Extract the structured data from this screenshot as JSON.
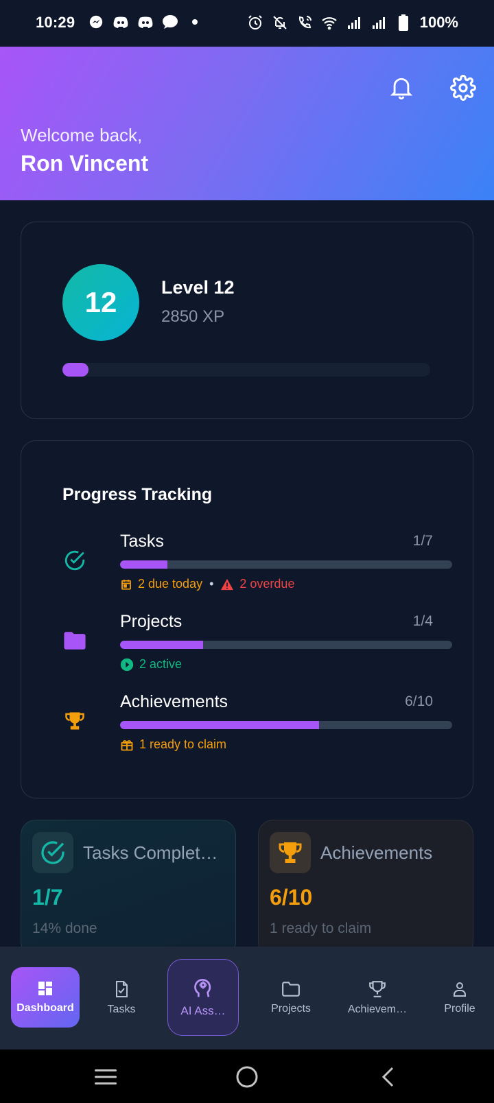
{
  "status_bar": {
    "time": "10:29",
    "battery": "100%",
    "icons_left": [
      "messenger-icon",
      "discord-icon",
      "discord-icon",
      "chat-bubble-icon",
      "dot-icon"
    ],
    "icons_right": [
      "alarm-icon",
      "bell-off-icon",
      "wifi-call-icon",
      "wifi-icon",
      "signal-icon",
      "signal-icon",
      "battery-icon"
    ]
  },
  "header": {
    "welcome": "Welcome back,",
    "username": "Ron Vincent",
    "gradient": [
      "#a855f7",
      "#3b82f6"
    ]
  },
  "level_card": {
    "level_number": "12",
    "level_label": "Level 12",
    "xp": "2850 XP",
    "progress_fraction": 0.07
  },
  "progress_tracking": {
    "title": "Progress Tracking",
    "rows": [
      {
        "label": "Tasks",
        "count": "1/7",
        "fraction": 0.143,
        "icon": "check-circle-icon",
        "sub": [
          {
            "icon": "calendar-icon",
            "text": "2 due today",
            "color": "#f59e0b"
          },
          {
            "icon": "warning-icon",
            "text": "2 overdue",
            "color": "#ef4444"
          }
        ]
      },
      {
        "label": "Projects",
        "count": "1/4",
        "fraction": 0.25,
        "icon": "folder-icon",
        "sub": [
          {
            "icon": "play-circle-icon",
            "text": "2 active",
            "color": "#10b981"
          }
        ]
      },
      {
        "label": "Achievements",
        "count": "6/10",
        "fraction": 0.6,
        "icon": "trophy-icon",
        "sub": [
          {
            "icon": "gift-icon",
            "text": "1 ready to claim",
            "color": "#f59e0b"
          }
        ]
      }
    ]
  },
  "stats": {
    "tasks": {
      "title": "Tasks Complet…",
      "value": "1/7",
      "sub": "14% done",
      "color": "#14b8a6"
    },
    "achievements": {
      "title": "Achievements",
      "value": "6/10",
      "sub": "1 ready to claim",
      "color": "#f59e0b"
    }
  },
  "bottom_nav": {
    "items": [
      {
        "label": "Dashboard",
        "icon": "grid-icon",
        "active": true
      },
      {
        "label": "Tasks",
        "icon": "task-icon"
      },
      {
        "label": "AI Ass…",
        "icon": "ai-brain-icon"
      },
      {
        "label": "Projects",
        "icon": "folder-icon"
      },
      {
        "label": "Achievem…",
        "icon": "trophy-icon"
      },
      {
        "label": "Profile",
        "icon": "person-icon"
      }
    ]
  },
  "colors": {
    "accent": "#a855f7",
    "background": "#0f172a",
    "nav_bg": "#1e293b"
  }
}
